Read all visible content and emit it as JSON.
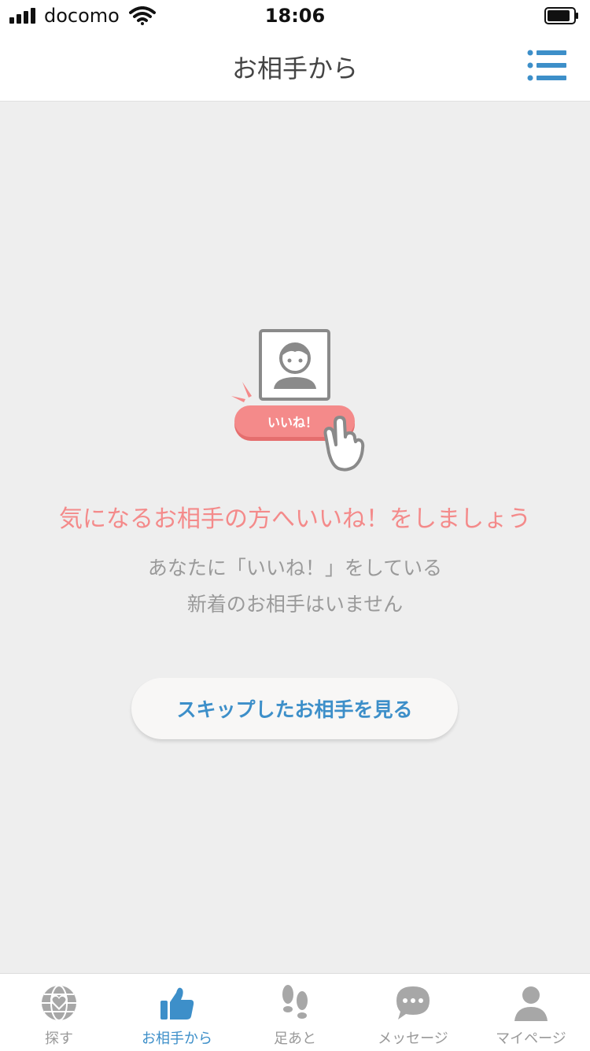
{
  "status_bar": {
    "carrier": "docomo",
    "time": "18:06"
  },
  "header": {
    "title": "お相手から",
    "menu_icon": "list-menu-icon"
  },
  "illustration": {
    "badge_label": "いいね！",
    "icons": [
      "profile-photo-icon",
      "like-badge-icon",
      "pointing-hand-icon"
    ]
  },
  "empty_state": {
    "title": "気になるお相手の方へいいね！をしましょう",
    "subtitle_line1": "あなたに「いいね！」をしている",
    "subtitle_line2": "新着のお相手はいません",
    "skip_button_label": "スキップしたお相手を見る"
  },
  "tabs": [
    {
      "label": "探す",
      "icon": "globe-heart-icon",
      "active": false
    },
    {
      "label": "お相手から",
      "icon": "thumbs-up-icon",
      "active": true
    },
    {
      "label": "足あと",
      "icon": "footprints-icon",
      "active": false
    },
    {
      "label": "メッセージ",
      "icon": "chat-bubble-icon",
      "active": false
    },
    {
      "label": "マイページ",
      "icon": "person-icon",
      "active": false
    }
  ],
  "colors": {
    "accent": "#3d8fc9",
    "pink": "#f48a8a",
    "tab_inactive": "#a7a7a7",
    "background": "#eeeeee"
  }
}
